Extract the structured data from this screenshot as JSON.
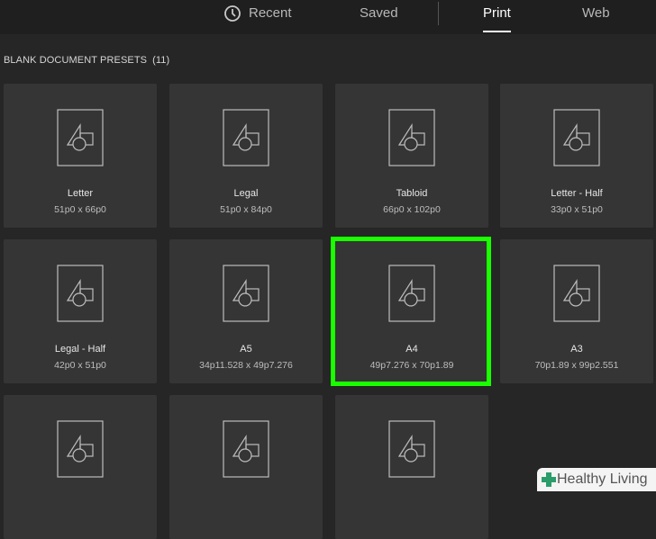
{
  "tabs": [
    {
      "label": "Recent",
      "icon": "clock-icon",
      "active": false
    },
    {
      "label": "Saved",
      "active": false
    },
    {
      "label": "Print",
      "active": true
    },
    {
      "label": "Web",
      "active": false
    }
  ],
  "section": {
    "title": "BLANK DOCUMENT PRESETS",
    "count": "(11)"
  },
  "presets": [
    {
      "name": "Letter",
      "size": "51p0 x 66p0"
    },
    {
      "name": "Legal",
      "size": "51p0 x 84p0"
    },
    {
      "name": "Tabloid",
      "size": "66p0 x 102p0"
    },
    {
      "name": "Letter - Half",
      "size": "33p0 x 51p0"
    },
    {
      "name": "Legal - Half",
      "size": "42p0 x 51p0"
    },
    {
      "name": "A5",
      "size": "34p11.528 x 49p7.276"
    },
    {
      "name": "A4",
      "size": "49p7.276 x 70p1.89",
      "highlighted": true
    },
    {
      "name": "A3",
      "size": "70p1.89 x 99p2.551"
    },
    {
      "name": "",
      "size": ""
    },
    {
      "name": "",
      "size": ""
    },
    {
      "name": "",
      "size": ""
    }
  ],
  "watermark": {
    "text": "Healthy Living",
    "icon": "plus-icon",
    "color": "#2a9d6a"
  },
  "colors": {
    "highlight": "#1aff00",
    "background": "#262626",
    "card": "#353535"
  }
}
